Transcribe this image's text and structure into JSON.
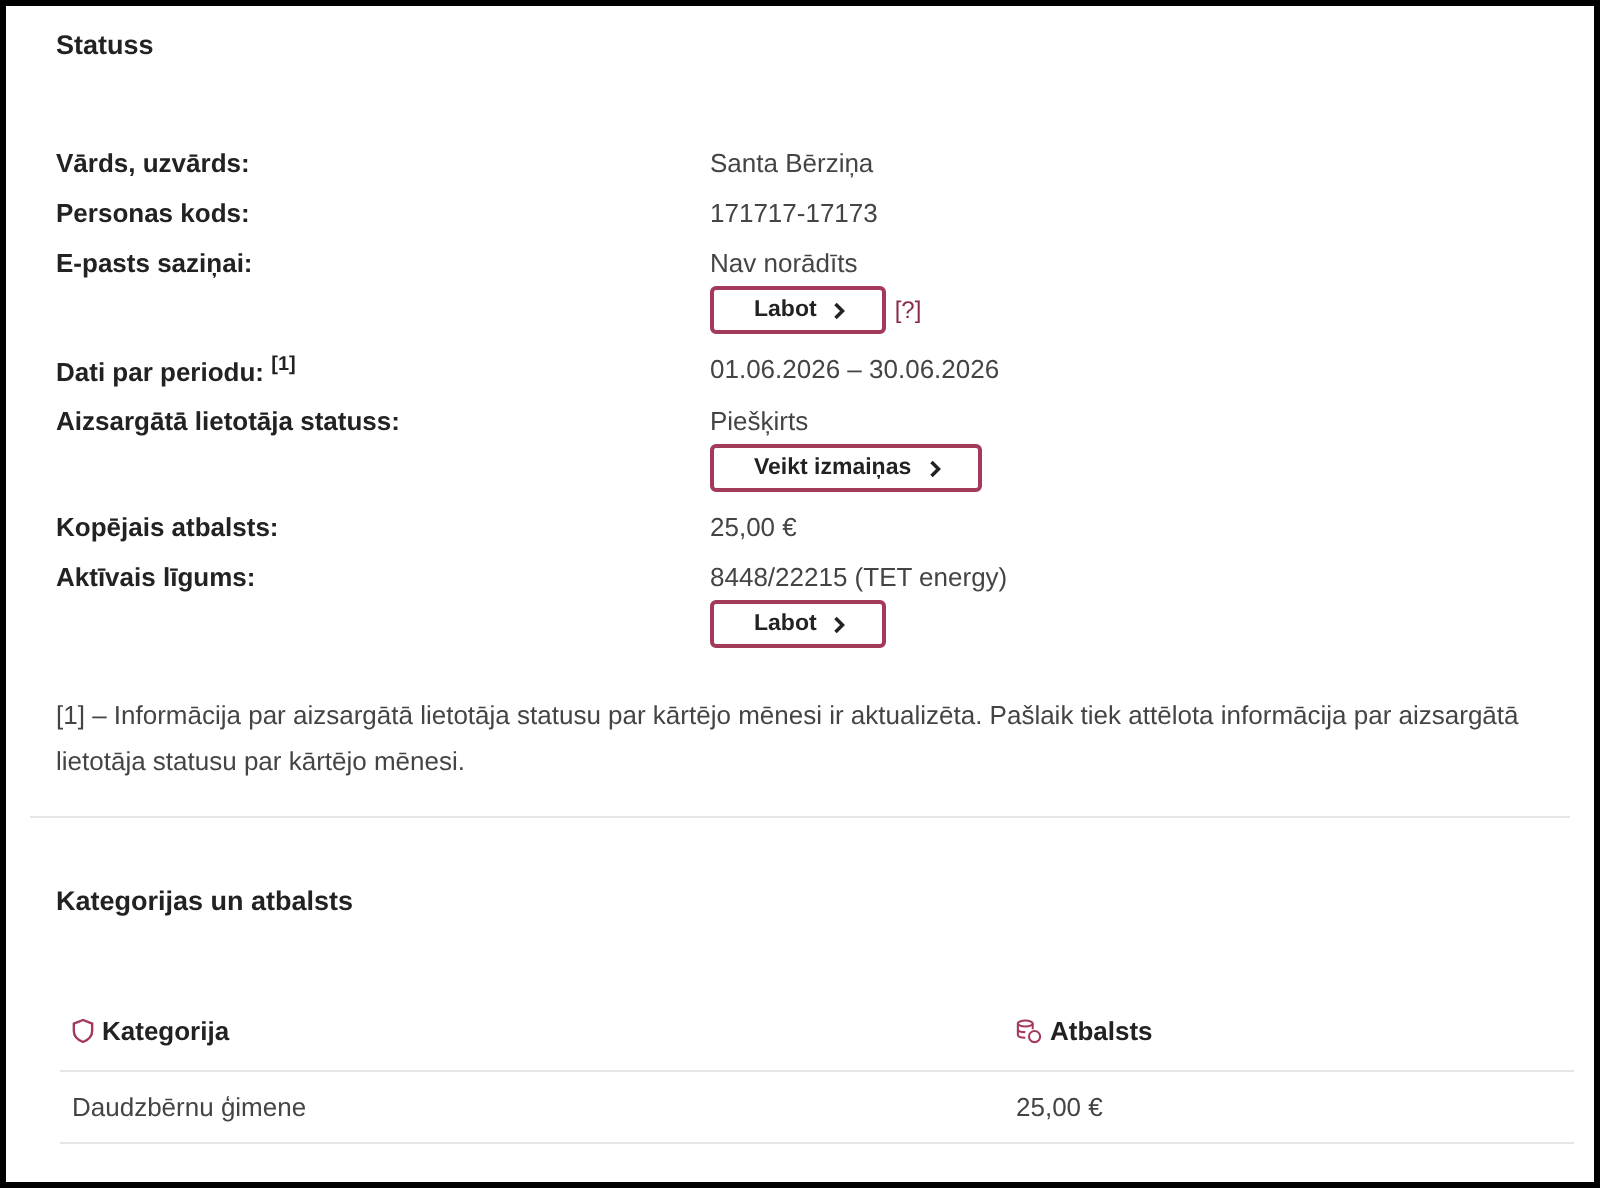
{
  "status": {
    "title": "Statuss",
    "rows": [
      {
        "label": "Vārds, uzvārds:",
        "value": "Santa Bērziņa"
      },
      {
        "label": "Personas kods:",
        "value": "171717-17173"
      },
      {
        "label": "E-pasts saziņai:",
        "value": "Nav norādīts",
        "button": "Labot",
        "help": "[?]"
      },
      {
        "label": "Dati par periodu: $^{[1]}$",
        "value": "01.06.2026 – 30.06.2026"
      },
      {
        "label": "Aizsargātā lietotāja statuss:",
        "value": "Piešķirts",
        "button": "Veikt izmaiņas"
      },
      {
        "label": "Kopējais atbalsts:",
        "value": "25,00 €"
      },
      {
        "label": "Aktīvais līgums:",
        "value": "8448/22215 (TET energy)",
        "button": "Labot"
      }
    ],
    "footnote": "[1] – Informācija par aizsargātā lietotāja statusu par kārtējo mēnesi ir aktualizēta. Pašlaik tiek attēlota informācija par aizsargātā lietotāja statusu par kārtējo mēnesi."
  },
  "categories": {
    "title": "Kategorijas un atbalsts",
    "table": {
      "columns": [
        "Kategorija",
        "Atbalsts"
      ],
      "rows": [
        [
          "Daudzbērnu ģimene",
          "25,00 €"
        ]
      ]
    }
  }
}
